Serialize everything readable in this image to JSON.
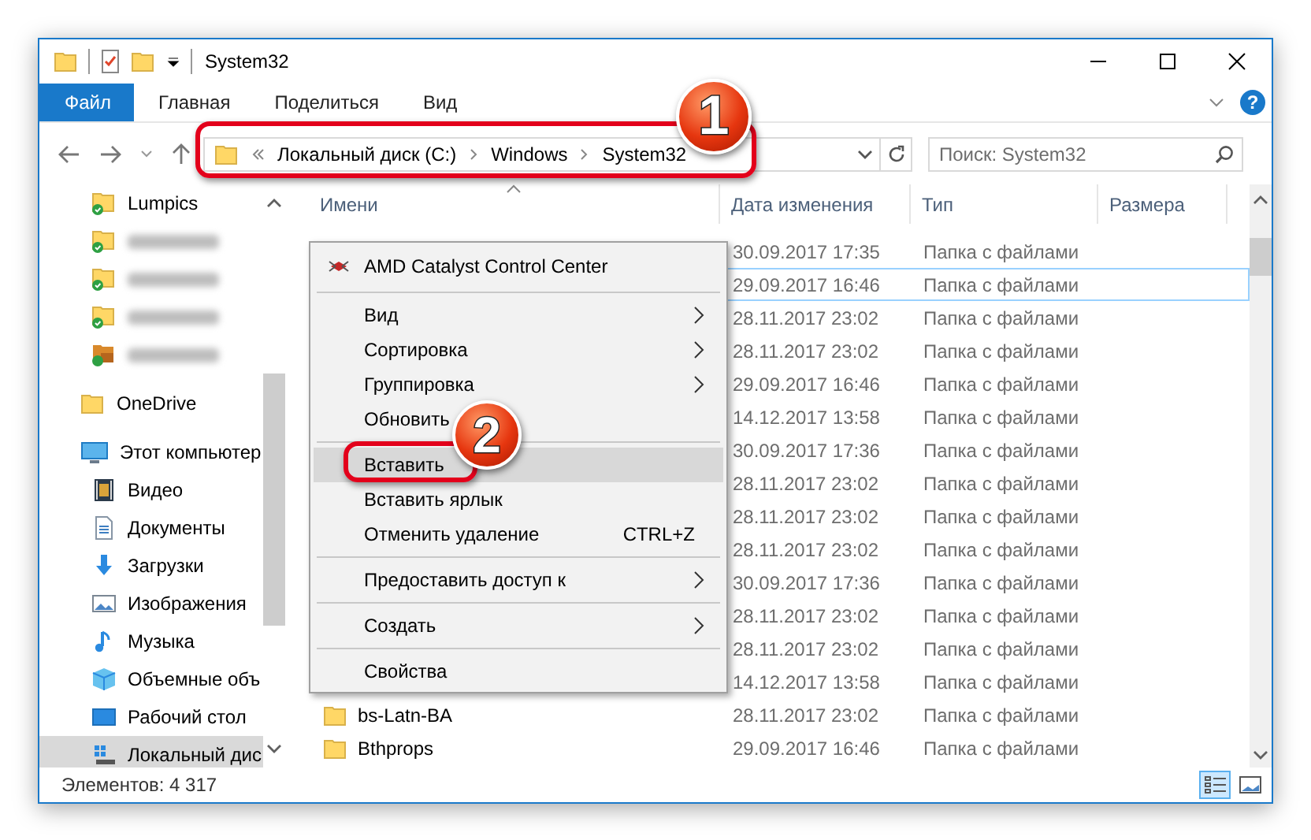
{
  "window": {
    "title": "System32"
  },
  "ribbon_tabs": [
    {
      "label": "Файл",
      "kind": "file"
    },
    {
      "label": "Главная",
      "kind": "tab"
    },
    {
      "label": "Поделиться",
      "kind": "tab"
    },
    {
      "label": "Вид",
      "kind": "tab"
    }
  ],
  "help_button": "?",
  "address_bar": {
    "path": [
      "Локальный диск (C:)",
      "Windows",
      "System32"
    ]
  },
  "search": {
    "placeholder": "Поиск: System32"
  },
  "sidebar": {
    "items": [
      {
        "label": "Lumpics",
        "kind": "synced",
        "selected": false
      },
      {
        "kind": "blurred",
        "selected": false
      },
      {
        "kind": "blurred",
        "selected": false
      },
      {
        "kind": "blurred",
        "selected": false
      },
      {
        "kind": "blurred-media",
        "selected": false
      },
      {
        "label": "OneDrive",
        "kind": "folder",
        "selected": false
      },
      {
        "label": "Этот компьютер",
        "kind": "computer",
        "selected": false,
        "children": [
          {
            "label": "Видео",
            "kind": "video",
            "selected": false
          },
          {
            "label": "Документы",
            "kind": "documents",
            "selected": false
          },
          {
            "label": "Загрузки",
            "kind": "downloads",
            "selected": false
          },
          {
            "label": "Изображения",
            "kind": "pictures",
            "selected": false
          },
          {
            "label": "Музыка",
            "kind": "music",
            "selected": false
          },
          {
            "label": "Объемные объ",
            "kind": "objects",
            "selected": false
          },
          {
            "label": "Рабочий стол",
            "kind": "desktop",
            "selected": false
          },
          {
            "label": "Локальный дис",
            "kind": "drive",
            "selected": true
          }
        ]
      }
    ]
  },
  "file_list": {
    "columns": [
      "Имени",
      "Дата изменения",
      "Тип",
      "Размера"
    ],
    "rows": [
      {
        "date": "30.09.2017 17:35",
        "type": "Папка с файлами",
        "focused": false
      },
      {
        "date": "29.09.2017 16:46",
        "type": "Папка с файлами",
        "focused": true
      },
      {
        "date": "28.11.2017 23:02",
        "type": "Папка с файлами",
        "focused": false
      },
      {
        "date": "28.11.2017 23:02",
        "type": "Папка с файлами",
        "focused": false
      },
      {
        "date": "29.09.2017 16:46",
        "type": "Папка с файлами",
        "focused": false
      },
      {
        "date": "14.12.2017 13:58",
        "type": "Папка с файлами",
        "focused": false
      },
      {
        "date": "30.09.2017 17:36",
        "type": "Папка с файлами",
        "focused": false
      },
      {
        "date": "28.11.2017 23:02",
        "type": "Папка с файлами",
        "focused": false
      },
      {
        "date": "28.11.2017 23:02",
        "type": "Папка с файлами",
        "focused": false
      },
      {
        "date": "28.11.2017 23:02",
        "type": "Папка с файлами",
        "focused": false
      },
      {
        "date": "30.09.2017 17:36",
        "type": "Папка с файлами",
        "focused": false
      },
      {
        "date": "28.11.2017 23:02",
        "type": "Папка с файлами",
        "focused": false
      },
      {
        "date": "28.11.2017 23:02",
        "type": "Папка с файлами",
        "focused": false
      },
      {
        "date": "14.12.2017 13:58",
        "type": "Папка с файлами",
        "focused": false
      },
      {
        "name": "bs-Latn-BA",
        "date": "28.11.2017 23:02",
        "type": "Папка с файлами",
        "focused": false
      },
      {
        "name": "Bthprops",
        "date": "29.09.2017 16:46",
        "type": "Папка с файлами",
        "focused": false
      }
    ]
  },
  "context_menu": {
    "items": [
      {
        "kind": "app",
        "label": "AMD Catalyst Control Center",
        "selected": false
      },
      {
        "kind": "separator"
      },
      {
        "kind": "submenu",
        "label": "Вид",
        "selected": false
      },
      {
        "kind": "submenu",
        "label": "Сортировка",
        "selected": false
      },
      {
        "kind": "submenu",
        "label": "Группировка",
        "selected": false
      },
      {
        "kind": "command",
        "label": "Обновить",
        "selected": false
      },
      {
        "kind": "separator"
      },
      {
        "kind": "command",
        "label": "Вставить",
        "selected": true
      },
      {
        "kind": "command",
        "label": "Вставить ярлык",
        "selected": false
      },
      {
        "kind": "command",
        "label": "Отменить удаление",
        "shortcut": "CTRL+Z",
        "selected": false
      },
      {
        "kind": "separator"
      },
      {
        "kind": "submenu",
        "label": "Предоставить доступ к",
        "selected": false
      },
      {
        "kind": "separator"
      },
      {
        "kind": "submenu",
        "label": "Создать",
        "selected": false
      },
      {
        "kind": "separator"
      },
      {
        "kind": "command",
        "label": "Свойства",
        "selected": false
      }
    ]
  },
  "callouts": [
    {
      "number": "1"
    },
    {
      "number": "2"
    }
  ],
  "status_bar": {
    "count": "Элементов: 4 317",
    "view_modes": [
      {
        "kind": "details",
        "selected": true
      },
      {
        "kind": "large-icons",
        "selected": false
      }
    ]
  }
}
